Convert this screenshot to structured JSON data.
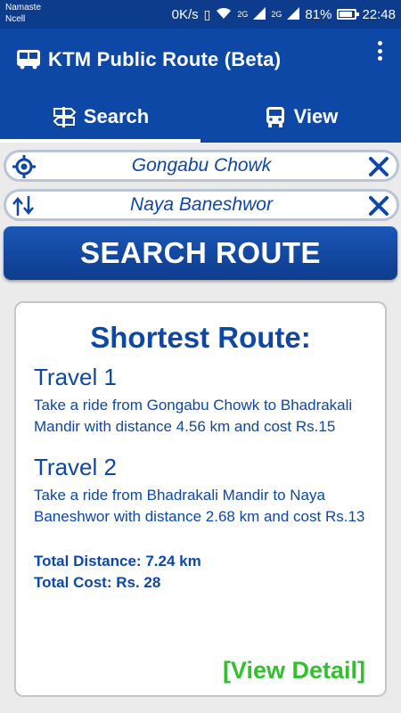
{
  "status_bar": {
    "carrier_line1": "Namaste",
    "carrier_line2": "Ncell",
    "speed": "0K/s",
    "network1": "2G",
    "network2": "2G",
    "battery": "81%",
    "time": "22:48"
  },
  "app_bar": {
    "title": "KTM Public Route (Beta)"
  },
  "tabs": [
    {
      "label": "Search",
      "icon": "signpost-icon"
    },
    {
      "label": "View",
      "icon": "bus-icon"
    }
  ],
  "search": {
    "origin": "Gongabu Chowk",
    "destination": "Naya Baneshwor",
    "button_label": "SEARCH ROUTE"
  },
  "result": {
    "title": "Shortest Route:",
    "travels": [
      {
        "title": "Travel 1",
        "description": "Take a ride from Gongabu Chowk to Bhadrakali Mandir with distance 4.56 km and cost Rs.15"
      },
      {
        "title": "Travel 2",
        "description": "Take a ride from Bhadrakali Mandir to Naya Baneshwor with distance 2.68 km and cost Rs.13"
      }
    ],
    "total_distance": "Total Distance: 7.24 km",
    "total_cost": "Total Cost: Rs. 28",
    "view_detail": "[View Detail]"
  },
  "colors": {
    "primary": "#0d48a6",
    "status_bar": "#0d3c8c",
    "accent_green": "#31c12c"
  }
}
